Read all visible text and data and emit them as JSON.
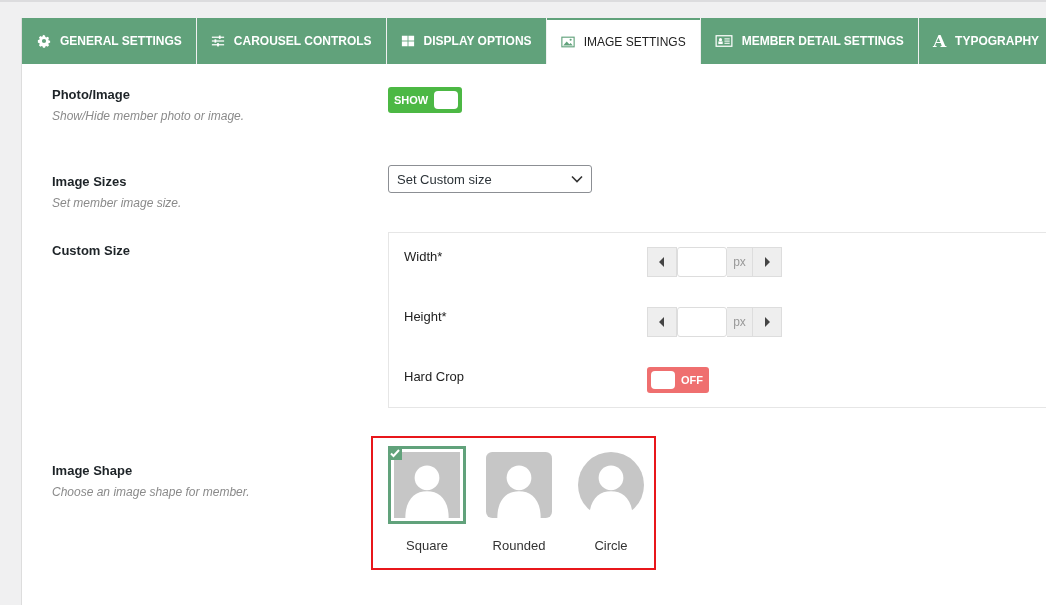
{
  "tabs": [
    {
      "label": "GENERAL SETTINGS",
      "selected": false
    },
    {
      "label": "CAROUSEL CONTROLS",
      "selected": false
    },
    {
      "label": "DISPLAY OPTIONS",
      "selected": false
    },
    {
      "label": "IMAGE SETTINGS",
      "selected": true
    },
    {
      "label": "MEMBER DETAIL SETTINGS",
      "selected": false
    },
    {
      "label": "TYPOGRAPHY",
      "glyph": "A",
      "selected": false
    }
  ],
  "photo_image": {
    "label": "Photo/Image",
    "help": "Show/Hide member photo or image.",
    "toggle": {
      "on": true,
      "text": "SHOW"
    }
  },
  "image_sizes": {
    "label": "Image Sizes",
    "help": "Set member image size.",
    "value": "Set Custom size"
  },
  "custom_size": {
    "label": "Custom Size",
    "fields": [
      {
        "label": "Width*",
        "unit": "px"
      },
      {
        "label": "Height*",
        "unit": "px"
      }
    ],
    "hard_crop": {
      "label": "Hard Crop",
      "toggle": {
        "on": false,
        "text": "OFF"
      }
    }
  },
  "image_shape": {
    "label": "Image Shape",
    "help": "Choose an image shape for member.",
    "options": [
      {
        "kind": "square",
        "label": "Square",
        "selected": true
      },
      {
        "kind": "rounded",
        "label": "Rounded",
        "selected": false
      },
      {
        "kind": "circle",
        "label": "Circle",
        "selected": false
      }
    ]
  }
}
